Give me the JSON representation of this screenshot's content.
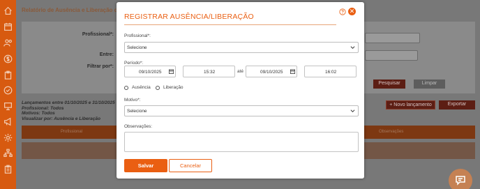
{
  "background": {
    "page_title": "Relatório de Ausência e Liberação de",
    "filters": {
      "profissional_label": "Profissional*:",
      "entre_label": "Entre:",
      "filtrar_por_label": "Filtrar por*:"
    },
    "buttons": {
      "pesquisar": "Pesquisar",
      "limpar": "Limpar",
      "novo_lancamento": "+ Novo lançamento",
      "exportar": "Exportar"
    },
    "summary": {
      "line1": "Lançamentos entre 01/10/2025 e 31/10/2025",
      "line2": "Profissional: Todos",
      "line3": "Motivos: Todos",
      "line4": "Visualizar por: Ausência e Liberação"
    },
    "table_headers": {
      "profissional": "Profissional",
      "observacoes": "Observações"
    }
  },
  "modal": {
    "title": "REGISTRAR AUSÊNCIA/LIBERAÇÃO",
    "profissional_label": "Profissional*:",
    "profissional_value": "Selecione",
    "periodo_label": "Período*:",
    "start_date": "09/10/2025",
    "start_time": "15:32",
    "ate_label": "até",
    "end_date": "09/10/2025",
    "end_time": "16:02",
    "radio_ausencia": "Ausência",
    "radio_liberacao": "Liberação",
    "motivo_label": "Motivo*:",
    "motivo_value": "Selecione",
    "observacoes_label": "Observações:",
    "save_label": "Salvar",
    "cancel_label": "Cancelar"
  },
  "colors": {
    "accent": "#ea5f12",
    "sidebar": "#d75a10"
  },
  "icons": {
    "sidebar": [
      "home-icon",
      "calendar-icon",
      "users-icon",
      "dollar-icon",
      "clipboard-icon",
      "check-circle-icon",
      "presentation-icon",
      "megaphone-icon",
      "gear-icon",
      "hierarchy-icon",
      "clipboard-list-icon"
    ],
    "modal": [
      "help-icon",
      "close-icon",
      "calendar-icon",
      "chevron-down-icon"
    ],
    "floating": "chat-icon"
  }
}
